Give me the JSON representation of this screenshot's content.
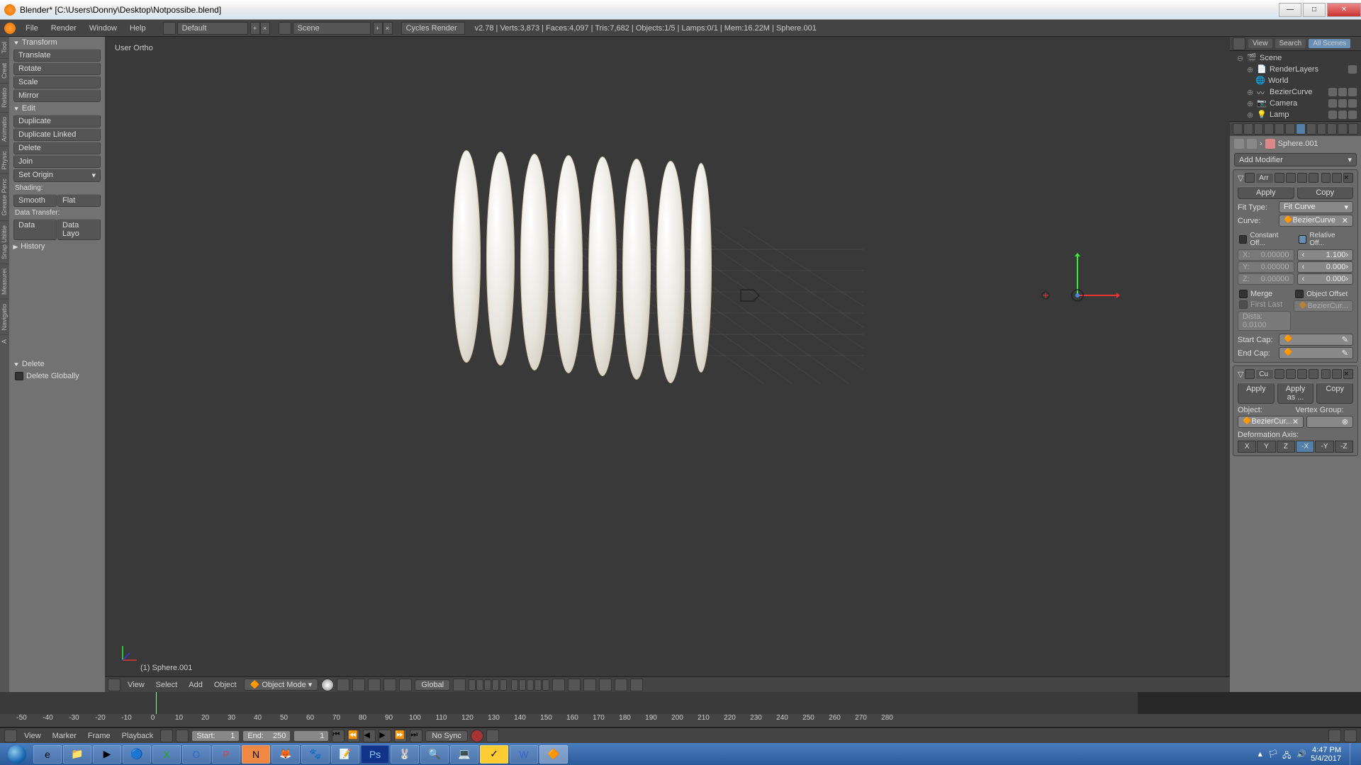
{
  "titlebar": {
    "text": "Blender* [C:\\Users\\Donny\\Desktop\\Notpossibe.blend]"
  },
  "menu": {
    "file": "File",
    "render": "Render",
    "window": "Window",
    "help": "Help",
    "layout": "Default",
    "scene": "Scene",
    "engine": "Cycles Render"
  },
  "stats": "v2.78 | Verts:3,873 | Faces:4,097 | Tris:7,682 | Objects:1/5 | Lamps:0/1 | Mem:16.22M | Sphere.001",
  "left_tabs": [
    "Tool",
    "Creat",
    "Relatio",
    "Animatio",
    "Physic",
    "Grease Penc",
    "Snap Utilitie",
    "Measurei",
    "Navigatio",
    "A"
  ],
  "tools": {
    "transform": {
      "title": "Transform",
      "items": [
        "Translate",
        "Rotate",
        "Scale",
        "Mirror"
      ]
    },
    "edit": {
      "title": "Edit",
      "items": [
        "Duplicate",
        "Duplicate Linked",
        "Delete",
        "Join"
      ],
      "origin": "Set Origin",
      "shading": "Shading:",
      "smooth": "Smooth",
      "flat": "Flat",
      "datatrans": "Data Transfer:",
      "data": "Data",
      "datalayo": "Data Layo"
    },
    "history": "History",
    "delete_sec": "Delete",
    "delete_globally": "Delete Globally"
  },
  "viewport": {
    "label": "User Ortho",
    "object_name": "(1) Sphere.001"
  },
  "vp_header": {
    "view": "View",
    "select": "Select",
    "add": "Add",
    "object": "Object",
    "mode": "Object Mode",
    "orient": "Global"
  },
  "outliner": {
    "view": "View",
    "search": "Search",
    "all": "All Scenes",
    "items": [
      {
        "name": "Scene"
      },
      {
        "name": "RenderLayers"
      },
      {
        "name": "World"
      },
      {
        "name": "BezierCurve"
      },
      {
        "name": "Camera"
      },
      {
        "name": "Lamp"
      }
    ]
  },
  "bc": {
    "object": "Sphere.001"
  },
  "props": {
    "add_mod": "Add Modifier",
    "mod1": {
      "name": "Arr",
      "apply": "Apply",
      "copy": "Copy",
      "fit_label": "Fit Type:",
      "fit": "Fit Curve",
      "curve_label": "Curve:",
      "curve": "BezierCurve",
      "const": "Constant Off...",
      "rel": "Relative Off...",
      "x_lbl": "X:",
      "y_lbl": "Y:",
      "z_lbl": "Z:",
      "const_x": "0.00000",
      "const_y": "0.00000",
      "const_z": "0.00000",
      "rel_x": "1.100",
      "rel_y": "0.000",
      "rel_z": "0.000",
      "merge": "Merge",
      "obj_off": "Object Offset",
      "first_last": "First Last",
      "bcur": "BezierCur...",
      "dista": "Dista: 0.0100",
      "start": "Start Cap:",
      "end": "End Cap:"
    },
    "mod2": {
      "name": "Cu",
      "apply": "Apply",
      "apply_as": "Apply as ...",
      "copy": "Copy",
      "obj": "Object:",
      "vgroup": "Vertex Group:",
      "bcur": "BezierCur...",
      "deform": "Deformation Axis:",
      "axes": [
        "X",
        "Y",
        "Z",
        "-X",
        "-Y",
        "-Z"
      ],
      "active": 3
    }
  },
  "timeline": {
    "ticks": [
      "-50",
      "-40",
      "-30",
      "-20",
      "-10",
      "0",
      "10",
      "20",
      "30",
      "40",
      "50",
      "60",
      "70",
      "80",
      "90",
      "100",
      "110",
      "120",
      "130",
      "140",
      "150",
      "160",
      "170",
      "180",
      "190",
      "200",
      "210",
      "220",
      "230",
      "240",
      "250",
      "260",
      "270",
      "280"
    ],
    "view": "View",
    "marker": "Marker",
    "frame": "Frame",
    "playback": "Playback",
    "start": "Start:",
    "start_v": "1",
    "end": "End:",
    "end_v": "250",
    "cur": "1",
    "sync": "No Sync"
  },
  "clock": {
    "time": "4:47 PM",
    "date": "5/4/2017"
  }
}
